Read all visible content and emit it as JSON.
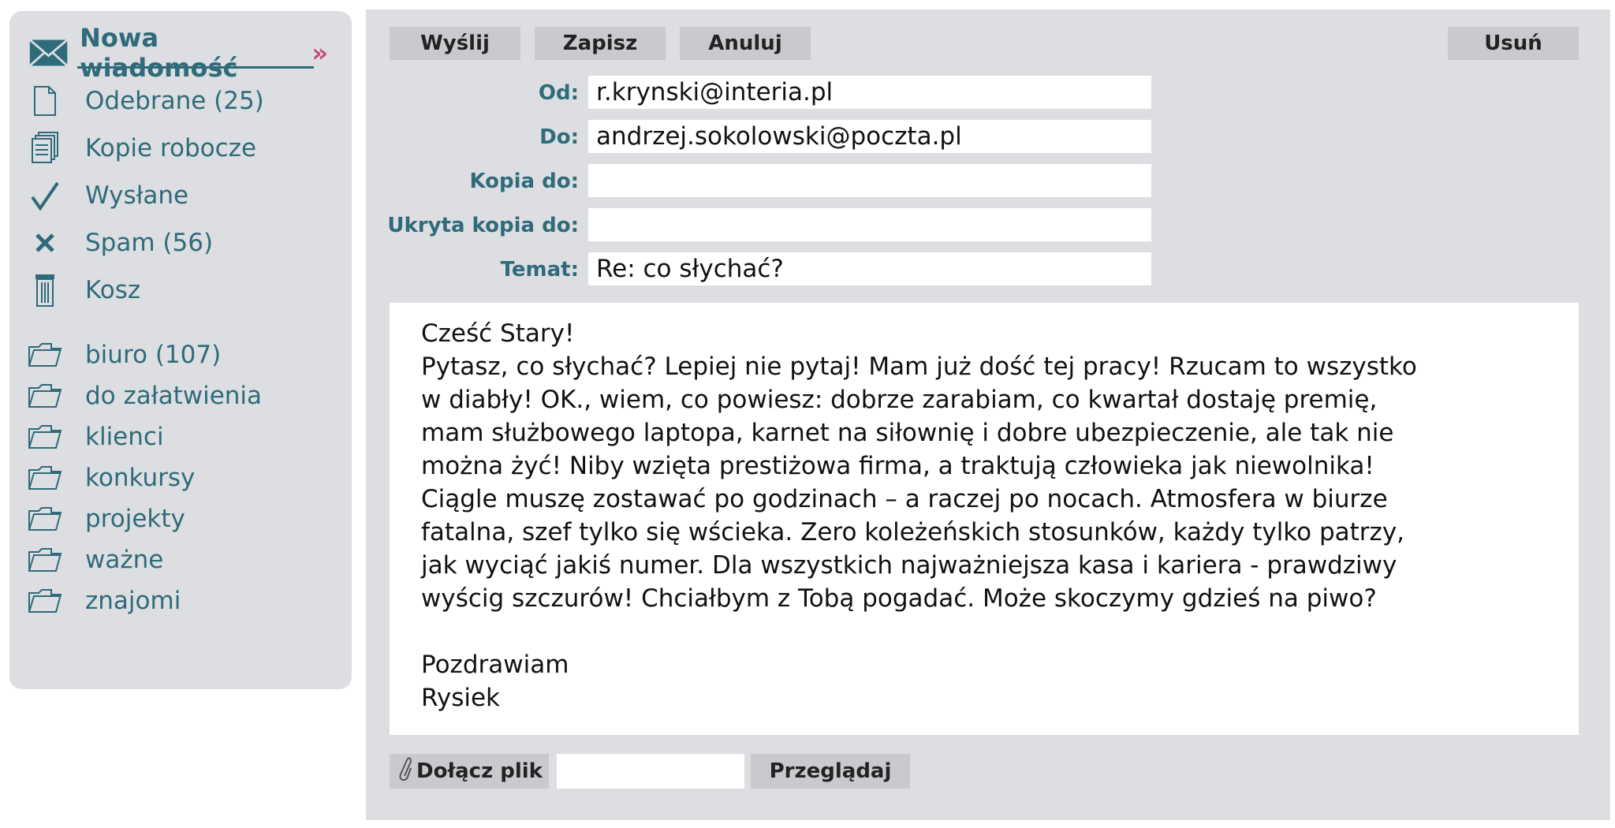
{
  "sidebar": {
    "compose_label": "Nowa wiadomość",
    "compose_arrow": "»",
    "nav": [
      {
        "label": "Odebrane (25)",
        "icon": "document-icon"
      },
      {
        "label": "Kopie robocze",
        "icon": "drafts-icon"
      },
      {
        "label": "Wysłane",
        "icon": "checkmark-icon"
      },
      {
        "label": "Spam (56)",
        "icon": "spam-x-icon"
      },
      {
        "label": "Kosz",
        "icon": "trash-icon"
      }
    ],
    "folders": [
      {
        "label": "biuro (107)"
      },
      {
        "label": "do załatwienia"
      },
      {
        "label": "klienci"
      },
      {
        "label": "konkursy"
      },
      {
        "label": "projekty"
      },
      {
        "label": "ważne"
      },
      {
        "label": "znajomi"
      }
    ]
  },
  "toolbar": {
    "send": "Wyślij",
    "save": "Zapisz",
    "cancel": "Anuluj",
    "delete": "Usuń"
  },
  "fields": {
    "from_label": "Od:",
    "from_value": "r.krynski@interia.pl",
    "to_label": "Do:",
    "to_value": "andrzej.sokolowski@poczta.pl",
    "cc_label": "Kopia do:",
    "cc_value": "",
    "bcc_label": "Ukryta kopia do:",
    "bcc_value": "",
    "subject_label": "Temat:",
    "subject_value": "Re: co słychać?"
  },
  "body": {
    "greeting": "Cześć Stary!",
    "lines": [
      "Pytasz, co słychać? Lepiej nie pytaj! Mam już dość tej pracy! Rzucam to wszystko",
      "w diabły! OK., wiem, co powiesz: dobrze zarabiam, co kwartał dostaję premię,",
      "mam służbowego laptopa, karnet na siłownię i dobre ubezpieczenie, ale tak nie",
      "można żyć! Niby wzięta prestiżowa firma, a traktują człowieka jak niewolnika!",
      "Ciągle muszę zostawać po godzinach – a raczej po nocach. Atmosfera w biurze",
      "fatalna, szef tylko się wścieka. Zero koleżeńskich stosunków, każdy tylko patrzy,",
      "jak wyciąć jakiś numer. Dla wszystkich najważniejsza kasa i kariera -  prawdziwy",
      "wyścig szczurów! Chciałbym z Tobą pogadać. Może skoczymy gdzieś na piwo?"
    ],
    "closing": "Pozdrawiam",
    "signature": "Rysiek"
  },
  "attachments": {
    "attach_label": "Dołącz plik",
    "browse_label": "Przeglądaj"
  }
}
